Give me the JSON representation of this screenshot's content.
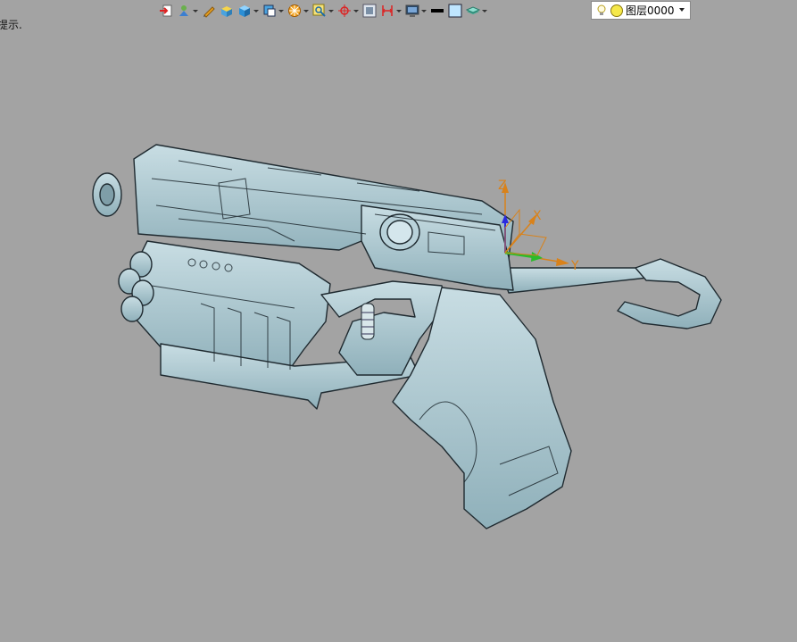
{
  "status": {
    "hint_text": "提示."
  },
  "toolbar": {
    "layer_name": "图层0000",
    "icons": [
      "import-icon",
      "render-icon",
      "pen-icon",
      "solid-box-icon",
      "cube-icon",
      "display-mode-icon",
      "view-orientation-icon",
      "zoom-icon",
      "snap-icon",
      "frame-icon",
      "measure-icon",
      "screen-icon",
      "line-color-icon",
      "fill-color-icon",
      "layer-stack-icon"
    ]
  },
  "axes": {
    "x_label": "X",
    "y_label": "Y",
    "z_label": "Z"
  },
  "colors": {
    "background": "#a3a3a3",
    "model_fill": "#a9c4cc",
    "model_edge": "#1f2a30",
    "axis_x": "#d9821a",
    "axis_y": "#2bbb2b",
    "axis_z": "#2a2adf"
  }
}
